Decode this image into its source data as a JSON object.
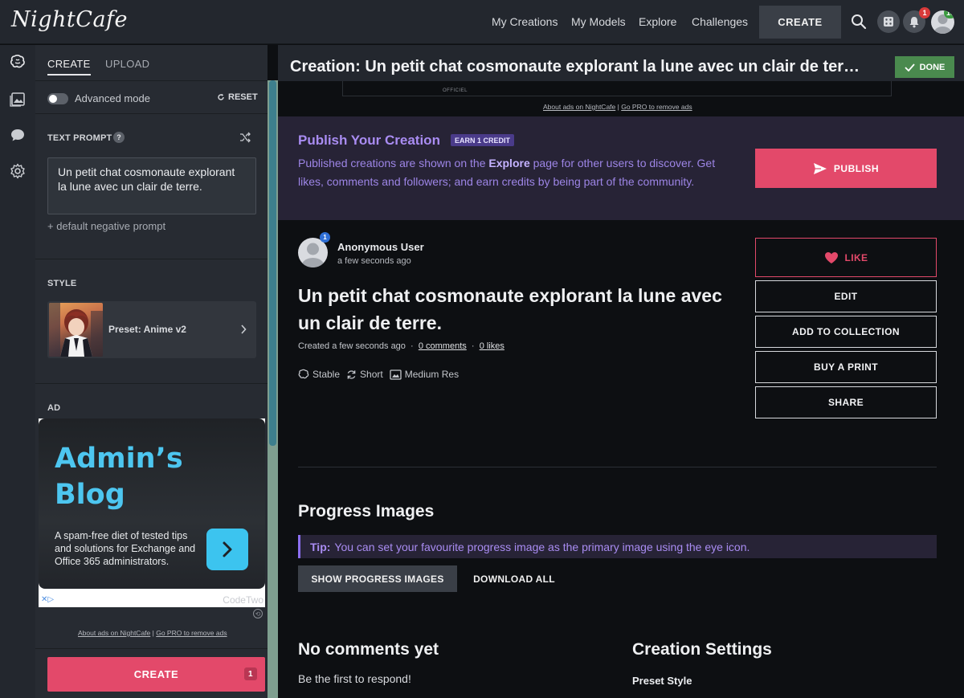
{
  "app": {
    "logo": "NightCafe"
  },
  "nav": {
    "links": [
      "My Creations",
      "My Models",
      "Explore",
      "Challenges"
    ],
    "create_label": "CREATE",
    "notifications_count": "1",
    "profile_count": "10"
  },
  "rail": {
    "icons": [
      "brain-icon",
      "gallery-icon",
      "chat-icon",
      "gear-icon"
    ]
  },
  "panel": {
    "tabs": {
      "create": "CREATE",
      "upload": "UPLOAD"
    },
    "advanced_mode_label": "Advanced mode",
    "advanced_mode_on": false,
    "reset_label": "RESET",
    "text_prompt_label": "TEXT PROMPT",
    "prompt_value": "Un petit chat cosmonaute explorant la lune avec un clair de terre.",
    "negative_prompt_label": "+ default negative prompt",
    "style_label": "STYLE",
    "style_preset": "Preset: Anime v2",
    "ad_label": "AD",
    "ad": {
      "title": "Admin’s Blog",
      "text": "A spam-free diet of tested tips and solutions for Exchange and Office 365 administrators.",
      "brand": "CodeTwo"
    },
    "ad_footer": {
      "about": "About ads on NightCafe",
      "separator": "|",
      "pro": "Go PRO to remove ads"
    },
    "create_button": "CREATE",
    "create_count": "1"
  },
  "main": {
    "header_title": "Creation: Un petit chat cosmonaute explorant la lune avec un clair de ter…",
    "done_label": "DONE",
    "top_ad_text": "OFFICIEL",
    "ad_footer": {
      "about": "About ads on NightCafe",
      "separator": "|",
      "pro": "Go PRO to remove ads"
    },
    "publish": {
      "title": "Publish Your Creation",
      "badge": "EARN 1 CREDIT",
      "text_before": "Published creations are shown on the ",
      "text_bold": "Explore",
      "text_after": " page for other users to discover. Get likes, comments and followers; and earn credits by being part of the community.",
      "button": "PUBLISH"
    },
    "user": {
      "name": "Anonymous User",
      "time": "a few seconds ago",
      "badge": "1"
    },
    "creation_title": "Un petit chat cosmonaute explorant la lune avec un clair de terre.",
    "meta": {
      "created": "Created a few seconds ago",
      "sep": "·",
      "comments": "0 comments",
      "likes": "0 likes"
    },
    "tags": [
      "Stable",
      "Short",
      "Medium Res"
    ],
    "actions": {
      "like": "LIKE",
      "edit": "EDIT",
      "add_to_collection": "ADD TO COLLECTION",
      "buy_print": "BUY A PRINT",
      "share": "SHARE"
    },
    "progress": {
      "heading": "Progress Images",
      "tip_label": "Tip:",
      "tip_text": "You can set your favourite progress image as the primary image using the eye icon.",
      "show_button": "SHOW PROGRESS IMAGES",
      "download_button": "DOWNLOAD ALL"
    },
    "comments": {
      "heading": "No comments yet",
      "subtext": "Be the first to respond!"
    },
    "settings": {
      "heading": "Creation Settings",
      "preset_style_label": "Preset Style"
    }
  },
  "colors": {
    "accent_pink": "#e3496a",
    "publish_purple": "#a98cf2",
    "done_green": "#4a8a4e"
  }
}
